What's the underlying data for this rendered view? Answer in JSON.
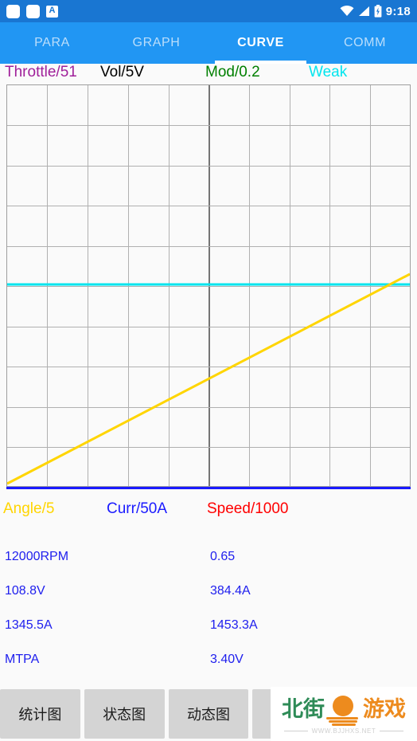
{
  "status_bar": {
    "icons": [
      "rounded-square-icon",
      "rounded-square-icon",
      "letter-a-badge-icon"
    ],
    "badge_letter": "A",
    "right_icons": [
      "wifi-icon",
      "signal-icon",
      "battery-charging-icon"
    ],
    "time": "9:18",
    "background": "#1976d2"
  },
  "tabs": {
    "background": "#2196f3",
    "active_index": 2,
    "items": [
      {
        "label": "PARA"
      },
      {
        "label": "GRAPH"
      },
      {
        "label": "CURVE"
      },
      {
        "label": "COMM"
      }
    ]
  },
  "chart_data": {
    "type": "line",
    "title": "",
    "xlabel": "",
    "ylabel": "",
    "grid": true,
    "grid_cols": 10,
    "grid_rows": 10,
    "xlim": [
      0,
      10
    ],
    "ylim": [
      0,
      10
    ],
    "legend_position": "top-and-bottom",
    "top_legend": [
      {
        "label": "Throttle/51",
        "color": "#a0209a"
      },
      {
        "label": "Vol/5V",
        "color": "#000000"
      },
      {
        "label": "Mod/0.2",
        "color": "#008000"
      },
      {
        "label": "Weak",
        "color": "#00e5ee"
      }
    ],
    "bottom_legend": [
      {
        "label": "Angle/5",
        "color": "#ffd500"
      },
      {
        "label": "Curr/50A",
        "color": "#1a1aff"
      },
      {
        "label": "Speed/1000",
        "color": "#ff0000"
      }
    ],
    "series": [
      {
        "name": "Weak",
        "color": "#00e5ee",
        "type": "horizontal-line",
        "x": [
          0,
          10
        ],
        "values": [
          5.05,
          5.05
        ]
      },
      {
        "name": "Angle/5",
        "color": "#ffd500",
        "type": "diagonal-ramp",
        "x": [
          0,
          10
        ],
        "values": [
          0.0,
          5.25
        ]
      },
      {
        "name": "Throttle/51",
        "color": "#a0209a",
        "type": "not-plotted",
        "x": [],
        "values": []
      },
      {
        "name": "Vol/5V",
        "color": "#000000",
        "type": "not-plotted",
        "x": [],
        "values": []
      },
      {
        "name": "Mod/0.2",
        "color": "#008000",
        "type": "not-plotted",
        "x": [],
        "values": []
      },
      {
        "name": "Curr/50A",
        "color": "#1a1aff",
        "type": "not-plotted",
        "x": [],
        "values": []
      },
      {
        "name": "Speed/1000",
        "color": "#ff0000",
        "type": "not-plotted",
        "x": [],
        "values": []
      }
    ],
    "axis_bottom_color": "#1a1aff",
    "grid_color": "#b0b0b0",
    "center_grid_color": "#757575"
  },
  "readouts": {
    "text_color": "#2020ee",
    "rows": [
      {
        "left": "12000RPM",
        "right": "0.65"
      },
      {
        "left": "108.8V",
        "right": "384.4A"
      },
      {
        "left": "1345.5A",
        "right": "1453.3A"
      },
      {
        "left": "MTPA",
        "right": "3.40V"
      }
    ]
  },
  "bottom_buttons": {
    "background": "#d4d4d4",
    "selected_background": "#7ec4f0",
    "items": [
      {
        "label": "统计图",
        "selected": false
      },
      {
        "label": "状态图",
        "selected": false
      },
      {
        "label": "动态图",
        "selected": false
      },
      {
        "label": "",
        "selected": false
      },
      {
        "label": "",
        "selected": true
      }
    ]
  },
  "watermark": {
    "text_green": "北街",
    "text_orange": "游戏",
    "url": "WWW.BJJHXS.NET",
    "green": "#2e8b57",
    "orange": "#ed8b1e"
  }
}
